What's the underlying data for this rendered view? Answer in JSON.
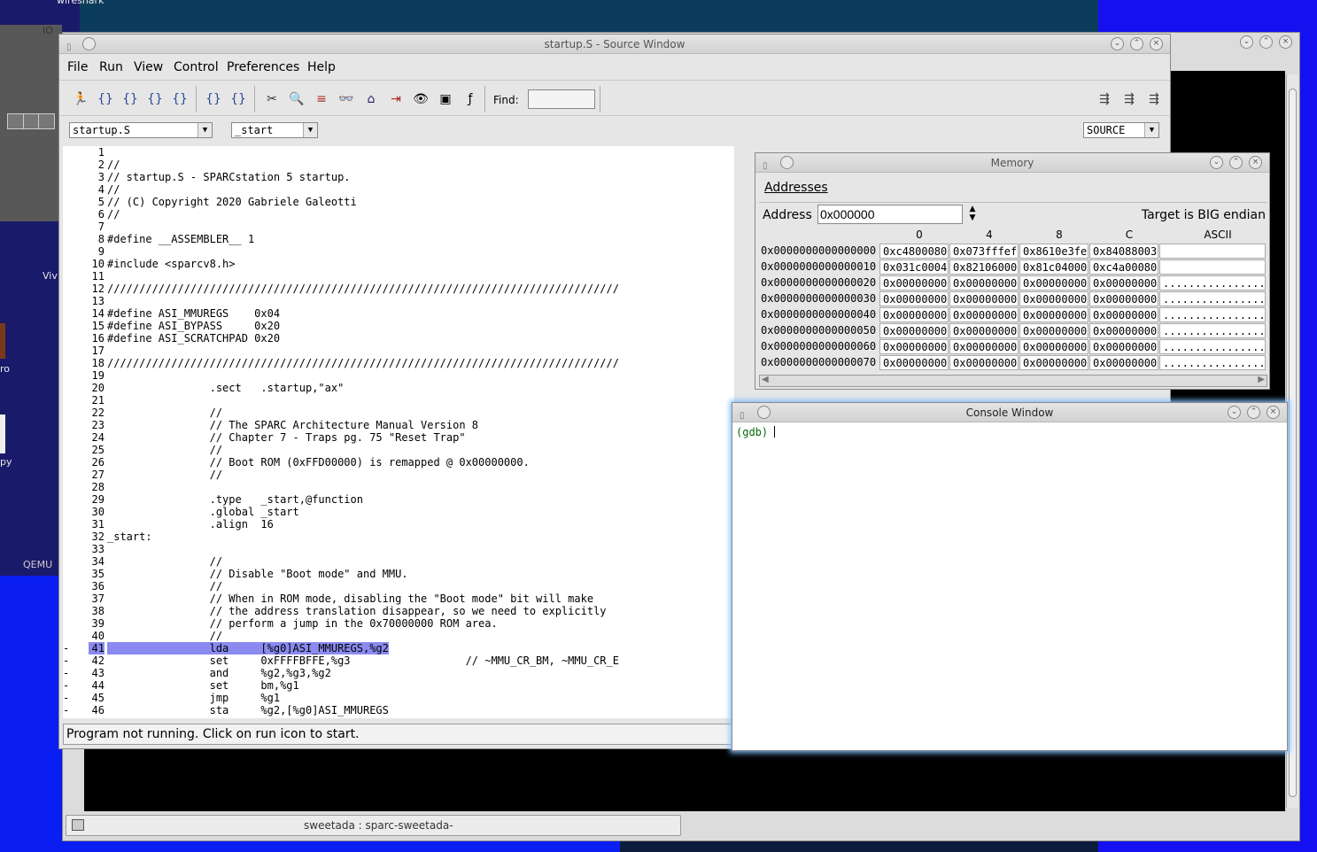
{
  "desktop": {
    "top_label": "wireshark",
    "top_label2": "IO",
    "left_labels": [
      "Viv",
      "ro",
      "py",
      "QEMU"
    ]
  },
  "terminal": {
    "taskbar_label": "sweetada : sparc-sweetada-"
  },
  "source_window": {
    "title": "startup.S - Source Window",
    "menu": [
      "File",
      "Run",
      "View",
      "Control",
      "Preferences",
      "Help"
    ],
    "find_label": "Find:",
    "file_combo": "startup.S",
    "func_combo": "_start",
    "mode_combo": "SOURCE",
    "status": "Program not running. Click on run icon to start.",
    "code_lines": [
      {
        "n": "1",
        "t": ""
      },
      {
        "n": "2",
        "t": "//"
      },
      {
        "n": "3",
        "t": "// startup.S - SPARCstation 5 startup."
      },
      {
        "n": "4",
        "t": "//"
      },
      {
        "n": "5",
        "t": "// (C) Copyright 2020 Gabriele Galeotti"
      },
      {
        "n": "6",
        "t": "//"
      },
      {
        "n": "7",
        "t": ""
      },
      {
        "n": "8",
        "t": "#define __ASSEMBLER__ 1"
      },
      {
        "n": "9",
        "t": ""
      },
      {
        "n": "10",
        "t": "#include <sparcv8.h>"
      },
      {
        "n": "11",
        "t": ""
      },
      {
        "n": "12",
        "t": "////////////////////////////////////////////////////////////////////////////////"
      },
      {
        "n": "13",
        "t": ""
      },
      {
        "n": "14",
        "t": "#define ASI_MMUREGS    0x04"
      },
      {
        "n": "15",
        "t": "#define ASI_BYPASS     0x20"
      },
      {
        "n": "16",
        "t": "#define ASI_SCRATCHPAD 0x20"
      },
      {
        "n": "17",
        "t": ""
      },
      {
        "n": "18",
        "t": "////////////////////////////////////////////////////////////////////////////////"
      },
      {
        "n": "19",
        "t": ""
      },
      {
        "n": "20",
        "t": "                .sect   .startup,\"ax\""
      },
      {
        "n": "21",
        "t": ""
      },
      {
        "n": "22",
        "t": "                //"
      },
      {
        "n": "23",
        "t": "                // The SPARC Architecture Manual Version 8"
      },
      {
        "n": "24",
        "t": "                // Chapter 7 - Traps pg. 75 \"Reset Trap\""
      },
      {
        "n": "25",
        "t": "                //"
      },
      {
        "n": "26",
        "t": "                // Boot ROM (0xFFD00000) is remapped @ 0x00000000."
      },
      {
        "n": "27",
        "t": "                //"
      },
      {
        "n": "28",
        "t": ""
      },
      {
        "n": "29",
        "t": "                .type   _start,@function"
      },
      {
        "n": "30",
        "t": "                .global _start"
      },
      {
        "n": "31",
        "t": "                .align  16"
      },
      {
        "n": "32",
        "t": "_start:"
      },
      {
        "n": "33",
        "t": ""
      },
      {
        "n": "34",
        "t": "                //"
      },
      {
        "n": "35",
        "t": "                // Disable \"Boot mode\" and MMU."
      },
      {
        "n": "36",
        "t": "                //"
      },
      {
        "n": "37",
        "t": "                // When in ROM mode, disabling the \"Boot mode\" bit will make"
      },
      {
        "n": "38",
        "t": "                // the address translation disappear, so we need to explicitly"
      },
      {
        "n": "39",
        "t": "                // perform a jump in the 0x70000000 ROM area."
      },
      {
        "n": "40",
        "t": "                //"
      },
      {
        "n": "41",
        "t": "                lda     [%g0]ASI_MMUREGS,%g2",
        "m": "-",
        "hl": true
      },
      {
        "n": "42",
        "t": "                set     0xFFFFBFFE,%g3                  // ~MMU_CR_BM, ~MMU_CR_E",
        "m": "-"
      },
      {
        "n": "43",
        "t": "                and     %g2,%g3,%g2",
        "m": "-"
      },
      {
        "n": "44",
        "t": "                set     bm,%g1",
        "m": "-"
      },
      {
        "n": "45",
        "t": "                jmp     %g1",
        "m": "-"
      },
      {
        "n": "46",
        "t": "                sta     %g2,[%g0]ASI_MMUREGS",
        "m": "-"
      }
    ]
  },
  "memory_window": {
    "title": "Memory",
    "menu_label": "Addresses",
    "address_label": "Address",
    "address_value": "0x000000",
    "endian_text": "Target is BIG endian",
    "col_headers": [
      "0",
      "4",
      "8",
      "C",
      "ASCII"
    ],
    "rows": [
      {
        "addr": "0x0000000000000000",
        "v": [
          "0xc4800080",
          "0x073fffef",
          "0x8610e3fe",
          "0x84088003"
        ],
        "ascii": ""
      },
      {
        "addr": "0x0000000000000010",
        "v": [
          "0x031c0004",
          "0x82106000",
          "0x81c04000",
          "0xc4a00080"
        ],
        "ascii": ""
      },
      {
        "addr": "0x0000000000000020",
        "v": [
          "0x00000000",
          "0x00000000",
          "0x00000000",
          "0x00000000"
        ],
        "ascii": "................"
      },
      {
        "addr": "0x0000000000000030",
        "v": [
          "0x00000000",
          "0x00000000",
          "0x00000000",
          "0x00000000"
        ],
        "ascii": "................"
      },
      {
        "addr": "0x0000000000000040",
        "v": [
          "0x00000000",
          "0x00000000",
          "0x00000000",
          "0x00000000"
        ],
        "ascii": "................"
      },
      {
        "addr": "0x0000000000000050",
        "v": [
          "0x00000000",
          "0x00000000",
          "0x00000000",
          "0x00000000"
        ],
        "ascii": "................"
      },
      {
        "addr": "0x0000000000000060",
        "v": [
          "0x00000000",
          "0x00000000",
          "0x00000000",
          "0x00000000"
        ],
        "ascii": "................"
      },
      {
        "addr": "0x0000000000000070",
        "v": [
          "0x00000000",
          "0x00000000",
          "0x00000000",
          "0x00000000"
        ],
        "ascii": "................"
      }
    ]
  },
  "console_window": {
    "title": "Console Window",
    "prompt": "(gdb)"
  },
  "colors": {
    "highlight": "#8a8af0",
    "prompt": "#0a6a0a",
    "focus_glow": "#7fbfff"
  }
}
